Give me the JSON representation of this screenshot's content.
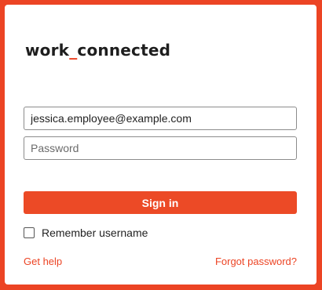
{
  "logo": {
    "part1": "work",
    "separator": "_",
    "part2": "connected"
  },
  "form": {
    "username_value": "jessica.employee@example.com",
    "password_placeholder": "Password",
    "password_value": "",
    "signin_label": "Sign in",
    "remember_label": "Remember username",
    "remember_checked": false
  },
  "links": {
    "help": "Get help",
    "forgot": "Forgot password?"
  },
  "colors": {
    "brand": "#ec4424",
    "button": "#ec4a26",
    "text": "#1e1e1e"
  }
}
